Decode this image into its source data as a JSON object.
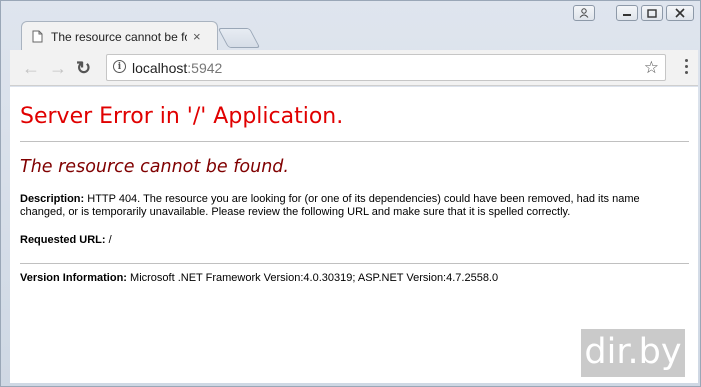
{
  "browser": {
    "tab_title": "The resource cannot be fou",
    "tab_close": "×",
    "address_host": "localhost",
    "address_port": ":5942",
    "nav": {
      "back": "←",
      "forward": "→",
      "reload": "↻"
    },
    "star": "☆"
  },
  "page": {
    "title": "Server Error in '/' Application.",
    "subtitle": "The resource cannot be found.",
    "description_label": "Description:",
    "description_text": " HTTP 404. The resource you are looking for (or one of its dependencies) could have been removed, had its name changed, or is temporarily unavailable.  Please review the following URL and make sure that it is spelled correctly.",
    "requested_url_label": "Requested URL:",
    "requested_url_value": " /",
    "version_label": "Version Information:",
    "version_text": " Microsoft .NET Framework Version:4.0.30319; ASP.NET Version:4.7.2558.0"
  },
  "watermark": "dir.by",
  "colors": {
    "title": "#e00000",
    "subtitle": "#800000"
  }
}
